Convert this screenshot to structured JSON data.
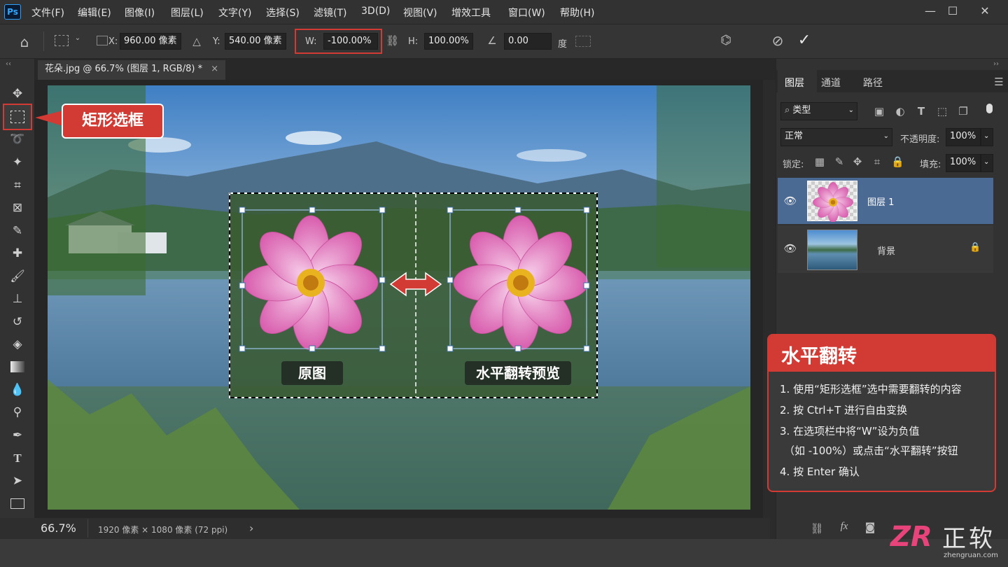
{
  "app": {
    "logo": "Ps",
    "menus": [
      "文件(F)",
      "编辑(E)",
      "图像(I)",
      "图层(L)",
      "文字(Y)",
      "选择(S)",
      "滤镜(T)",
      "3D(D)",
      "视图(V)",
      "增效工具",
      "窗口(W)",
      "帮助(H)"
    ],
    "window_controls": [
      "—",
      "☐",
      "✕"
    ]
  },
  "options": {
    "x_label": "X:",
    "x_value": "960.00 像素",
    "y_label": "Y:",
    "y_value": "540.00 像素",
    "w_label": "W:",
    "w_value": "-100.00%",
    "h_label": "H:",
    "h_value": "100.00%",
    "angle_value": "0.00",
    "angle_unit": "度"
  },
  "document": {
    "tab_title": "花朵.jpg @ 66.7% (图层 1, RGB/8) *",
    "tab_close": "×",
    "zoom": "66.7%",
    "dimensions": "1920 像素 × 1080 像素 (72 ppi)",
    "status_arrow": "›"
  },
  "canvas": {
    "label_original": "原图",
    "label_preview": "水平翻转预览"
  },
  "callouts": {
    "marquee": "矩形选框",
    "flip_title": "水平翻转",
    "steps": [
      "1. 使用“矩形选框”选中需要翻转的内容",
      "2. 按 Ctrl+T 进行自由变换",
      "3. 在选项栏中将“W”设为负值",
      "（如 -100%）或点击“水平翻转”按钮",
      "4. 按 Enter 确认"
    ]
  },
  "panel": {
    "tabs": [
      "图层",
      "通道",
      "路径"
    ],
    "filter_kind": "类型",
    "blend_mode": "正常",
    "opacity_label": "不透明度:",
    "opacity_value": "100%",
    "lock_label": "锁定:",
    "fill_label": "填充:",
    "fill_value": "100%",
    "layers": [
      {
        "name": "图层 1",
        "selected": true
      },
      {
        "name": "背景",
        "selected": false
      }
    ]
  },
  "watermark": {
    "brand": "正软",
    "site": "zhengruan.com"
  },
  "colors": {
    "accent_red": "#d23a34",
    "selected_layer": "#4b6a93",
    "ps_blue": "#31a8ff"
  }
}
